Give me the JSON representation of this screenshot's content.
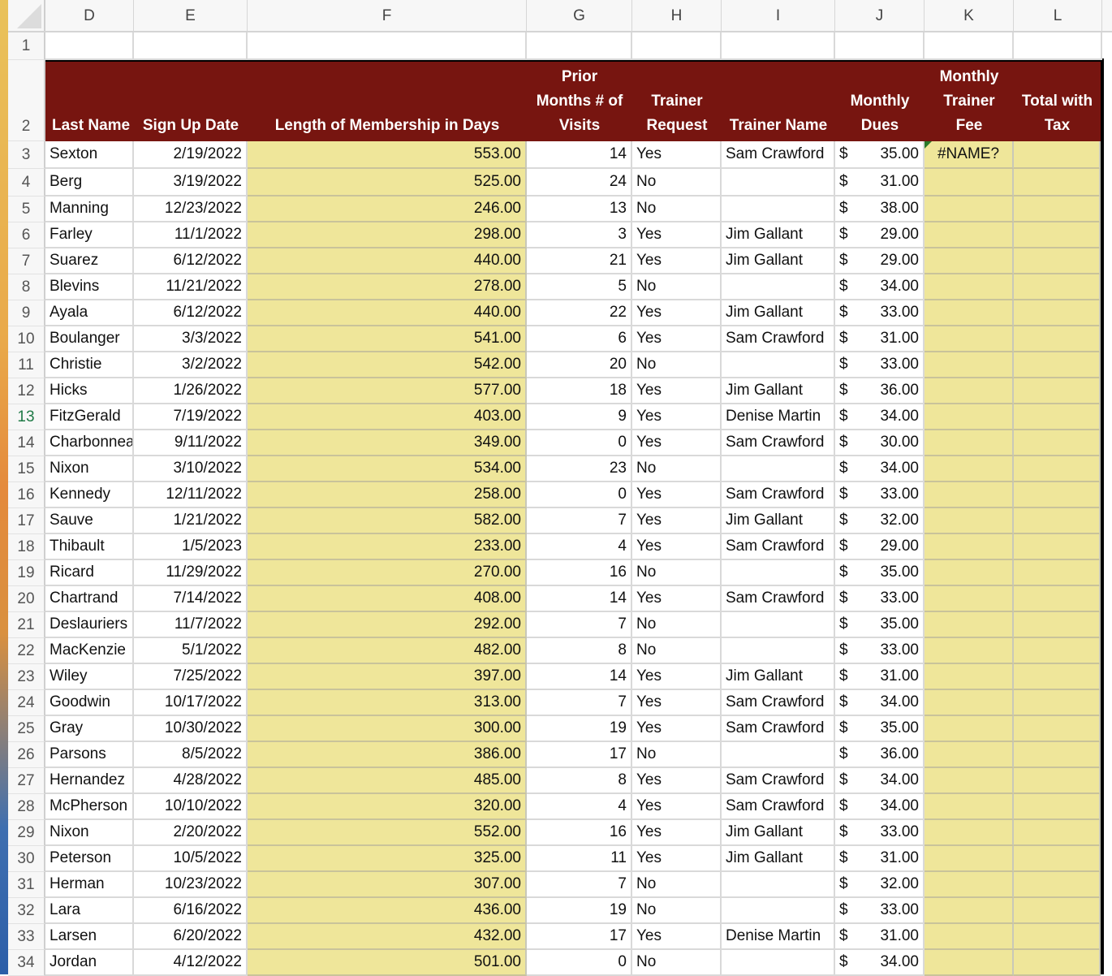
{
  "columns": [
    "D",
    "E",
    "F",
    "G",
    "H",
    "I",
    "J",
    "K",
    "L"
  ],
  "active_row": 13,
  "header_row": {
    "row_number": "2",
    "labels": [
      "Last Name",
      "Sign Up Date",
      "Length of Membership in Days",
      "Prior\nMonths # of\nVisits",
      "Trainer\nRequest",
      "Trainer Name",
      "Monthly\nDues",
      "Monthly\nTrainer\nFee",
      "Total with\nTax"
    ]
  },
  "blank_row_number": "1",
  "colors": {
    "header_fill": "#771510",
    "input_fill": "#efe69a",
    "error_flag": "#2a7a2a",
    "active_row_number": "#1f7a46"
  },
  "currency_symbol": "$",
  "rows": [
    {
      "n": "3",
      "last": "Sexton",
      "date": "2/19/2022",
      "days": "553.00",
      "visits": "14",
      "req": "Yes",
      "trainer": "Sam Crawford",
      "dues": "35.00",
      "fee": "#NAME?",
      "total": ""
    },
    {
      "n": "4",
      "last": "Berg",
      "date": "3/19/2022",
      "days": "525.00",
      "visits": "24",
      "req": "No",
      "trainer": "",
      "dues": "31.00",
      "fee": "",
      "total": ""
    },
    {
      "n": "5",
      "last": "Manning",
      "date": "12/23/2022",
      "days": "246.00",
      "visits": "13",
      "req": "No",
      "trainer": "",
      "dues": "38.00",
      "fee": "",
      "total": ""
    },
    {
      "n": "6",
      "last": "Farley",
      "date": "11/1/2022",
      "days": "298.00",
      "visits": "3",
      "req": "Yes",
      "trainer": "Jim Gallant",
      "dues": "29.00",
      "fee": "",
      "total": ""
    },
    {
      "n": "7",
      "last": "Suarez",
      "date": "6/12/2022",
      "days": "440.00",
      "visits": "21",
      "req": "Yes",
      "trainer": "Jim Gallant",
      "dues": "29.00",
      "fee": "",
      "total": ""
    },
    {
      "n": "8",
      "last": "Blevins",
      "date": "11/21/2022",
      "days": "278.00",
      "visits": "5",
      "req": "No",
      "trainer": "",
      "dues": "34.00",
      "fee": "",
      "total": ""
    },
    {
      "n": "9",
      "last": "Ayala",
      "date": "6/12/2022",
      "days": "440.00",
      "visits": "22",
      "req": "Yes",
      "trainer": "Jim Gallant",
      "dues": "33.00",
      "fee": "",
      "total": ""
    },
    {
      "n": "10",
      "last": "Boulanger",
      "date": "3/3/2022",
      "days": "541.00",
      "visits": "6",
      "req": "Yes",
      "trainer": "Sam Crawford",
      "dues": "31.00",
      "fee": "",
      "total": ""
    },
    {
      "n": "11",
      "last": "Christie",
      "date": "3/2/2022",
      "days": "542.00",
      "visits": "20",
      "req": "No",
      "trainer": "",
      "dues": "33.00",
      "fee": "",
      "total": ""
    },
    {
      "n": "12",
      "last": "Hicks",
      "date": "1/26/2022",
      "days": "577.00",
      "visits": "18",
      "req": "Yes",
      "trainer": "Jim Gallant",
      "dues": "36.00",
      "fee": "",
      "total": ""
    },
    {
      "n": "13",
      "last": "FitzGerald",
      "date": "7/19/2022",
      "days": "403.00",
      "visits": "9",
      "req": "Yes",
      "trainer": "Denise Martin",
      "dues": "34.00",
      "fee": "",
      "total": ""
    },
    {
      "n": "14",
      "last": "Charbonneau",
      "date": "9/11/2022",
      "days": "349.00",
      "visits": "0",
      "req": "Yes",
      "trainer": "Sam Crawford",
      "dues": "30.00",
      "fee": "",
      "total": ""
    },
    {
      "n": "15",
      "last": "Nixon",
      "date": "3/10/2022",
      "days": "534.00",
      "visits": "23",
      "req": "No",
      "trainer": "",
      "dues": "34.00",
      "fee": "",
      "total": ""
    },
    {
      "n": "16",
      "last": "Kennedy",
      "date": "12/11/2022",
      "days": "258.00",
      "visits": "0",
      "req": "Yes",
      "trainer": "Sam Crawford",
      "dues": "33.00",
      "fee": "",
      "total": ""
    },
    {
      "n": "17",
      "last": "Sauve",
      "date": "1/21/2022",
      "days": "582.00",
      "visits": "7",
      "req": "Yes",
      "trainer": "Jim Gallant",
      "dues": "32.00",
      "fee": "",
      "total": ""
    },
    {
      "n": "18",
      "last": "Thibault",
      "date": "1/5/2023",
      "days": "233.00",
      "visits": "4",
      "req": "Yes",
      "trainer": "Sam Crawford",
      "dues": "29.00",
      "fee": "",
      "total": ""
    },
    {
      "n": "19",
      "last": "Ricard",
      "date": "11/29/2022",
      "days": "270.00",
      "visits": "16",
      "req": "No",
      "trainer": "",
      "dues": "35.00",
      "fee": "",
      "total": ""
    },
    {
      "n": "20",
      "last": "Chartrand",
      "date": "7/14/2022",
      "days": "408.00",
      "visits": "14",
      "req": "Yes",
      "trainer": "Sam Crawford",
      "dues": "33.00",
      "fee": "",
      "total": ""
    },
    {
      "n": "21",
      "last": "Deslauriers",
      "date": "11/7/2022",
      "days": "292.00",
      "visits": "7",
      "req": "No",
      "trainer": "",
      "dues": "35.00",
      "fee": "",
      "total": ""
    },
    {
      "n": "22",
      "last": "MacKenzie",
      "date": "5/1/2022",
      "days": "482.00",
      "visits": "8",
      "req": "No",
      "trainer": "",
      "dues": "33.00",
      "fee": "",
      "total": ""
    },
    {
      "n": "23",
      "last": "Wiley",
      "date": "7/25/2022",
      "days": "397.00",
      "visits": "14",
      "req": "Yes",
      "trainer": "Jim Gallant",
      "dues": "31.00",
      "fee": "",
      "total": ""
    },
    {
      "n": "24",
      "last": "Goodwin",
      "date": "10/17/2022",
      "days": "313.00",
      "visits": "7",
      "req": "Yes",
      "trainer": "Sam Crawford",
      "dues": "34.00",
      "fee": "",
      "total": ""
    },
    {
      "n": "25",
      "last": "Gray",
      "date": "10/30/2022",
      "days": "300.00",
      "visits": "19",
      "req": "Yes",
      "trainer": "Sam Crawford",
      "dues": "35.00",
      "fee": "",
      "total": ""
    },
    {
      "n": "26",
      "last": "Parsons",
      "date": "8/5/2022",
      "days": "386.00",
      "visits": "17",
      "req": "No",
      "trainer": "",
      "dues": "36.00",
      "fee": "",
      "total": ""
    },
    {
      "n": "27",
      "last": "Hernandez",
      "date": "4/28/2022",
      "days": "485.00",
      "visits": "8",
      "req": "Yes",
      "trainer": "Sam Crawford",
      "dues": "34.00",
      "fee": "",
      "total": ""
    },
    {
      "n": "28",
      "last": "McPherson",
      "date": "10/10/2022",
      "days": "320.00",
      "visits": "4",
      "req": "Yes",
      "trainer": "Sam Crawford",
      "dues": "34.00",
      "fee": "",
      "total": ""
    },
    {
      "n": "29",
      "last": "Nixon",
      "date": "2/20/2022",
      "days": "552.00",
      "visits": "16",
      "req": "Yes",
      "trainer": "Jim Gallant",
      "dues": "33.00",
      "fee": "",
      "total": ""
    },
    {
      "n": "30",
      "last": "Peterson",
      "date": "10/5/2022",
      "days": "325.00",
      "visits": "11",
      "req": "Yes",
      "trainer": "Jim Gallant",
      "dues": "31.00",
      "fee": "",
      "total": ""
    },
    {
      "n": "31",
      "last": "Herman",
      "date": "10/23/2022",
      "days": "307.00",
      "visits": "7",
      "req": "No",
      "trainer": "",
      "dues": "32.00",
      "fee": "",
      "total": ""
    },
    {
      "n": "32",
      "last": "Lara",
      "date": "6/16/2022",
      "days": "436.00",
      "visits": "19",
      "req": "No",
      "trainer": "",
      "dues": "33.00",
      "fee": "",
      "total": ""
    },
    {
      "n": "33",
      "last": "Larsen",
      "date": "6/20/2022",
      "days": "432.00",
      "visits": "17",
      "req": "Yes",
      "trainer": "Denise Martin",
      "dues": "31.00",
      "fee": "",
      "total": ""
    },
    {
      "n": "34",
      "last": "Jordan",
      "date": "4/12/2022",
      "days": "501.00",
      "visits": "0",
      "req": "No",
      "trainer": "",
      "dues": "34.00",
      "fee": "",
      "total": ""
    }
  ]
}
